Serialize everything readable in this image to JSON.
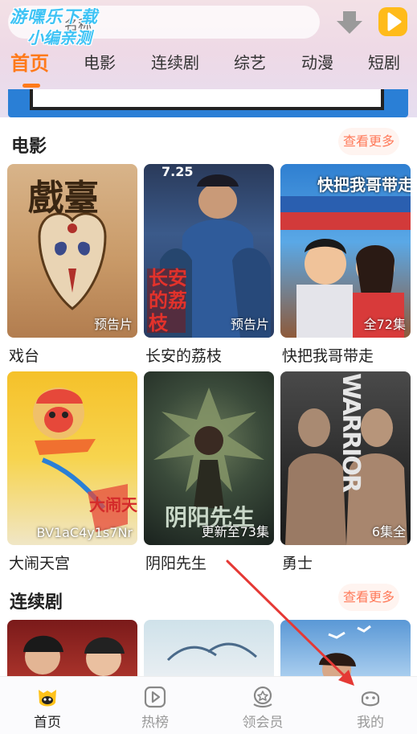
{
  "header": {
    "search_text": "名称",
    "watermark_line1": "游嘿乐下载",
    "watermark_line2": "小编亲测"
  },
  "tabs": [
    {
      "label": "首页",
      "active": true
    },
    {
      "label": "电影",
      "active": false
    },
    {
      "label": "连续剧",
      "active": false
    },
    {
      "label": "综艺",
      "active": false
    },
    {
      "label": "动漫",
      "active": false
    },
    {
      "label": "短剧",
      "active": false
    }
  ],
  "sections": {
    "movies": {
      "title": "电影",
      "more": "查看更多",
      "items": [
        {
          "title": "戏台",
          "badge": "预告片",
          "poster_text": "戲臺"
        },
        {
          "title": "长安的荔枝",
          "badge": "预告片",
          "poster_text": "长安的荔枝",
          "poster_date": "7.25"
        },
        {
          "title": "快把我哥带走",
          "badge": "全72集",
          "poster_text": "快把我哥带走"
        },
        {
          "title": "大闹天宫",
          "badge": "BV1aC4y1s7Nr",
          "poster_text": "大闹天宫"
        },
        {
          "title": "阴阳先生",
          "badge": "更新至73集",
          "poster_text": "阴阳先生"
        },
        {
          "title": "勇士",
          "badge": "6集全",
          "poster_text": "WARRIOR"
        }
      ]
    },
    "series": {
      "title": "连续剧",
      "more": "查看更多"
    }
  },
  "bottom_nav": [
    {
      "label": "首页",
      "icon": "home-face-icon",
      "active": true
    },
    {
      "label": "热榜",
      "icon": "play-square-icon",
      "active": false
    },
    {
      "label": "领会员",
      "icon": "vip-badge-icon",
      "active": false
    },
    {
      "label": "我的",
      "icon": "profile-face-icon",
      "active": false
    }
  ],
  "colors": {
    "accent": "#ff7a1a",
    "more_text": "#ff7a5a",
    "annotation_arrow": "#e53935"
  }
}
